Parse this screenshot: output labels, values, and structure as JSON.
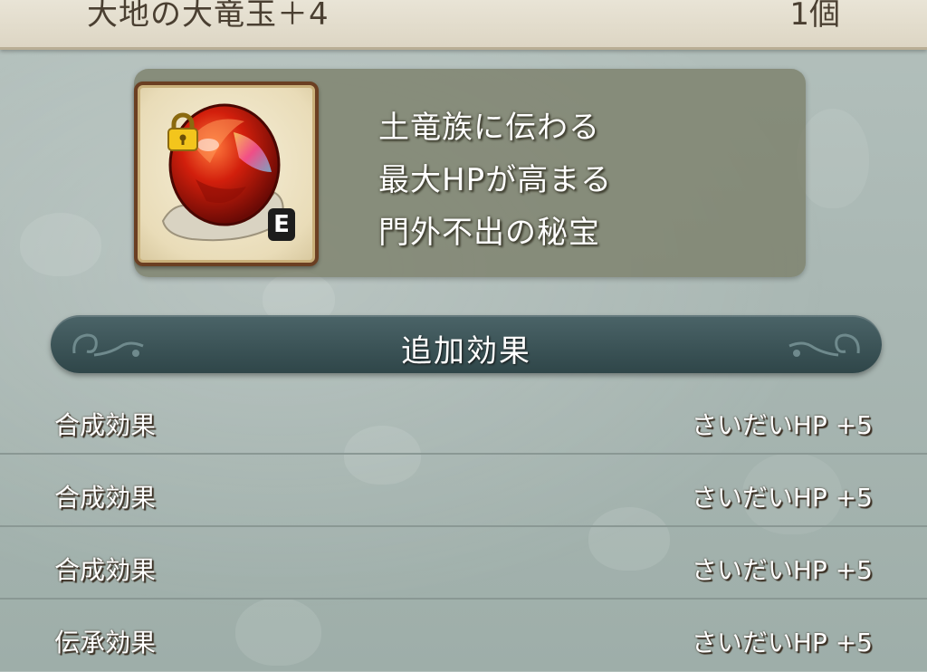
{
  "item": {
    "name": "大地の大竜玉＋4",
    "count": "1個",
    "badge": "E",
    "description": [
      "土竜族に伝わる",
      "最大HPが高まる",
      "門外不出の秘宝"
    ]
  },
  "section": {
    "title": "追加効果"
  },
  "effects": [
    {
      "name": "合成効果",
      "value": "さいだいHP  +5"
    },
    {
      "name": "合成効果",
      "value": "さいだいHP  +5"
    },
    {
      "name": "合成効果",
      "value": "さいだいHP  +5"
    },
    {
      "name": "伝承効果",
      "value": "さいだいHP  +5"
    }
  ],
  "colors": {
    "background": "#a9b7b3",
    "title_bar": "#e4dece",
    "panel": "#7a7e68",
    "section_header": "#3a5256",
    "gem": "#c8200f",
    "lock": "#f1c21b"
  },
  "icons": [
    "locked-padlock-icon",
    "red-gem-icon",
    "equipped-badge"
  ]
}
